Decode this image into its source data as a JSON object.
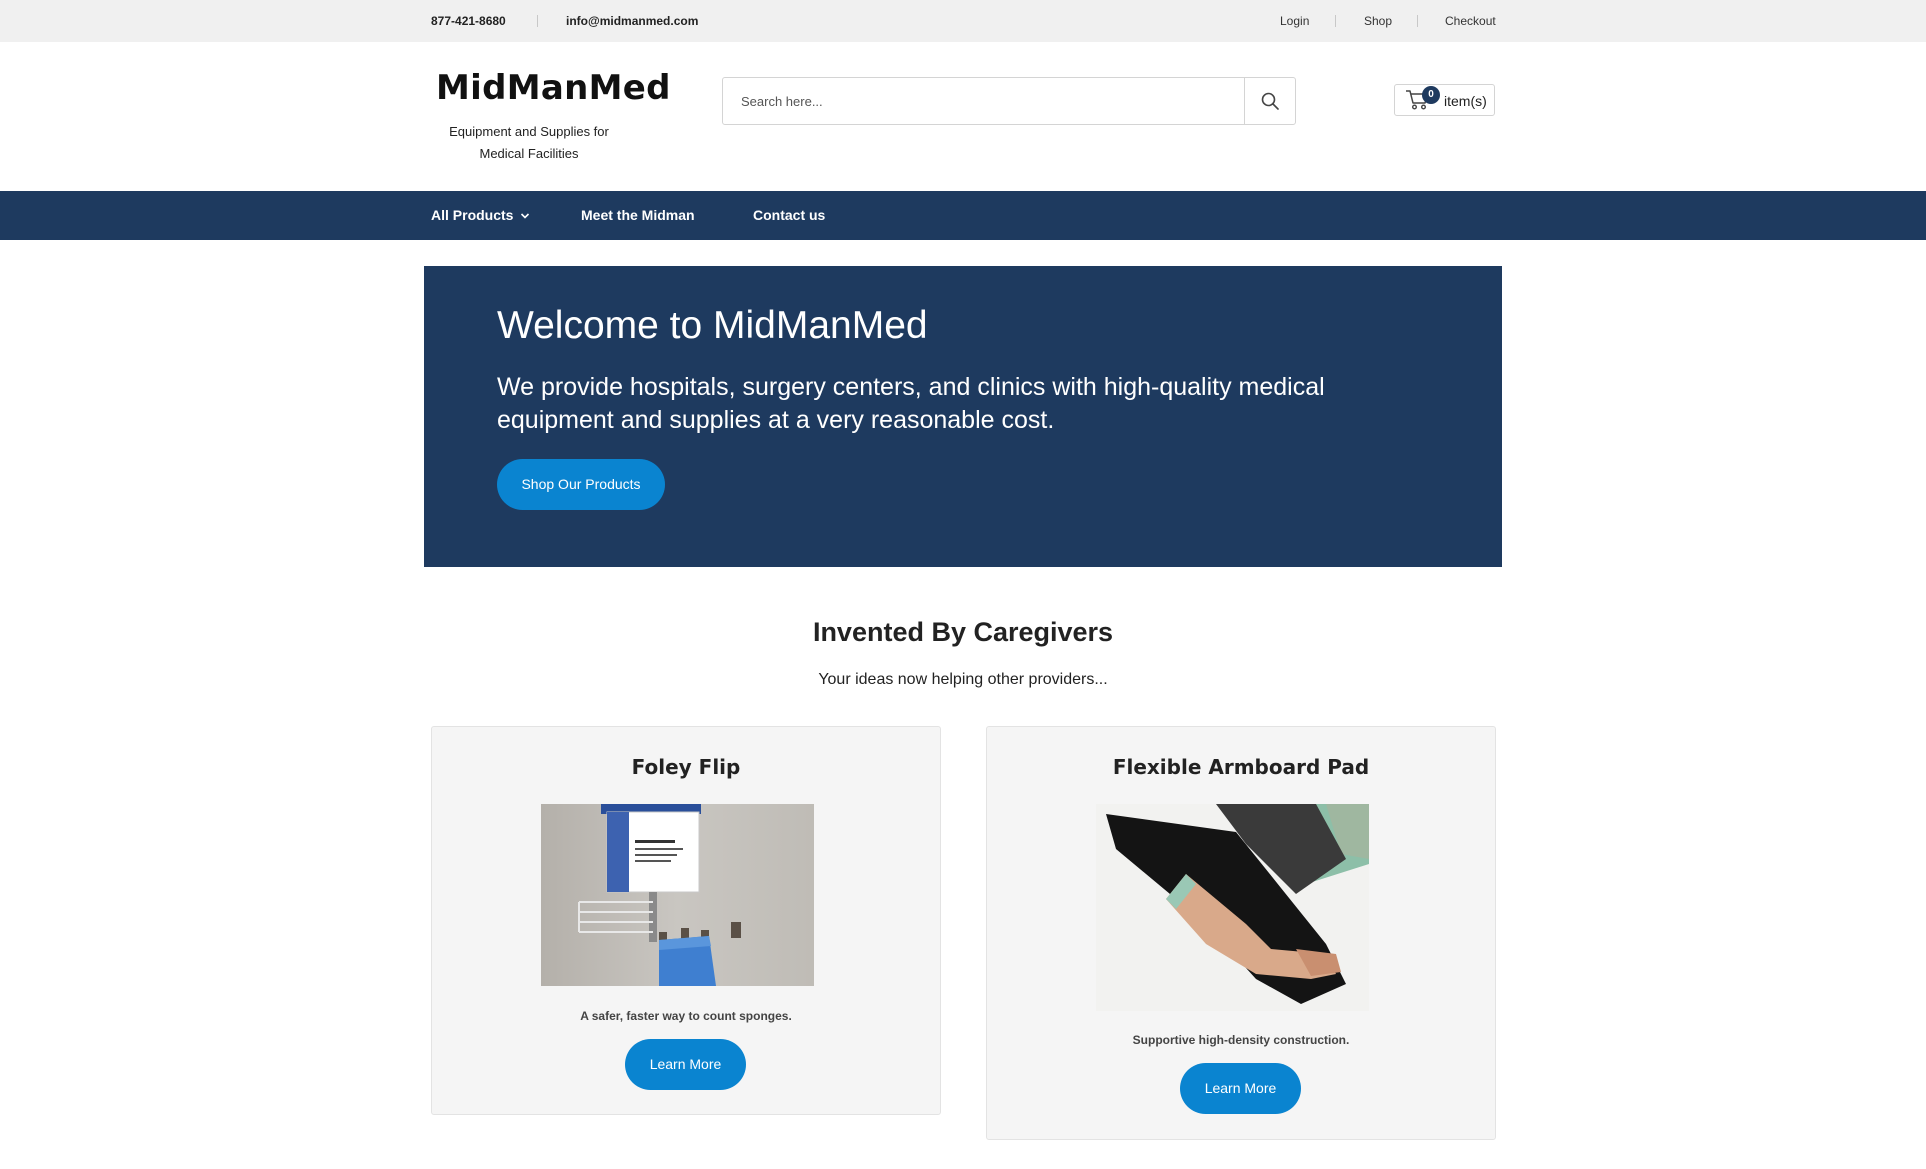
{
  "topbar": {
    "phone": "877-421-8680",
    "email": "info@midmanmed.com",
    "links": [
      "Login",
      "Shop",
      "Checkout"
    ]
  },
  "header": {
    "logo_title": "MidManMed",
    "logo_subtitle": "Equipment and Supplies for Medical Facilities",
    "search_placeholder": "Search here...",
    "cart_count": "0",
    "cart_label": "item(s)"
  },
  "nav": {
    "items": [
      "All Products",
      "Meet the Midman",
      "Contact us"
    ]
  },
  "hero": {
    "title": "Welcome to MidManMed",
    "text": "We provide hospitals, surgery centers, and clinics with high-quality medical equipment and supplies at a very reasonable cost.",
    "button": "Shop Our Products"
  },
  "section": {
    "title": "Invented By Caregivers",
    "subtitle": "Your ideas now helping other providers..."
  },
  "cards": [
    {
      "title": "Foley Flip",
      "desc": "A safer, faster way to count sponges.",
      "button": "Learn More"
    },
    {
      "title": "Flexible Armboard Pad",
      "desc": "Supportive high-density construction.",
      "button": "Learn More"
    }
  ],
  "colors": {
    "navy": "#1e3a5f",
    "accent_blue": "#0a84d0",
    "topbar_bg": "#f0f0f0"
  },
  "icons": {
    "search": "search-icon",
    "cart": "cart-icon",
    "dropdown": "chevron-down-icon"
  }
}
